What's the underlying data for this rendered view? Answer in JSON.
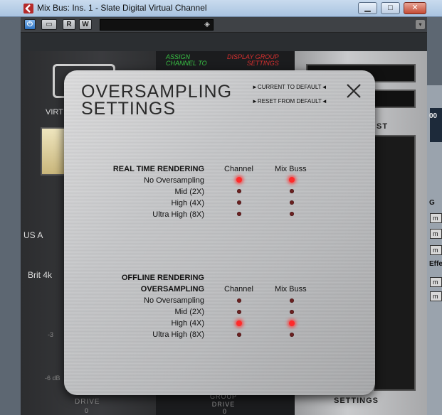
{
  "window": {
    "title": "Mix Bus: Ins. 1 - Slate Digital Virtual Channel",
    "minimize_symbol": "▁",
    "maximize_symbol": "□",
    "close_symbol": "✕"
  },
  "toolbar": {
    "power_label": "⏻",
    "compare_label": "▭",
    "read_label": "R",
    "write_label": "W",
    "preset_value": "",
    "menu_symbol": "▾"
  },
  "plugin": {
    "virt_label": "VIRT",
    "us_label": "US A",
    "brit_label": "Brit 4k",
    "scale_labels": [
      "-3",
      "-6 dB"
    ],
    "assign_label": "ASSIGN\nCHANNEL TO",
    "display_group_label": "DISPLAY GROUP\nSETTINGS",
    "drive_label": "DRIVE",
    "drive_value": "0",
    "group_drive_label": "GROUP\nDRIVE",
    "group_drive_value": "0",
    "st_label": "ST",
    "settings_label": "SETTINGS"
  },
  "daw_strip": {
    "labels": [
      "00",
      "G",
      "Effe"
    ],
    "buttons": [
      "m",
      "m",
      "m",
      "m",
      "m"
    ]
  },
  "dialog": {
    "title_line1": "OVERSAMPLING",
    "title_line2": "SETTINGS",
    "current_to_default": "►CURRENT TO DEFAULT◄",
    "reset_from_default": "►RESET FROM DEFAULT◄",
    "columns": [
      "Channel",
      "Mix Buss"
    ],
    "realtime": {
      "heading": "REAL TIME RENDERING",
      "options": [
        "No Oversampling",
        "Mid (2X)",
        "High (4X)",
        "Ultra High (8X)"
      ],
      "channel_selected": "No Oversampling",
      "mixbuss_selected": "No Oversampling"
    },
    "offline": {
      "heading_line1": "OFFLINE RENDERING",
      "heading_line2": "OVERSAMPLING",
      "options": [
        "No Oversampling",
        "Mid (2X)",
        "High (4X)",
        "Ultra High (8X)"
      ],
      "channel_selected": "High (4X)",
      "mixbuss_selected": "High (4X)"
    }
  },
  "colors": {
    "led_on": "#ff2a2a",
    "led_off": "#6b2020",
    "assign_green": "#39c245",
    "display_red": "#d83030"
  }
}
